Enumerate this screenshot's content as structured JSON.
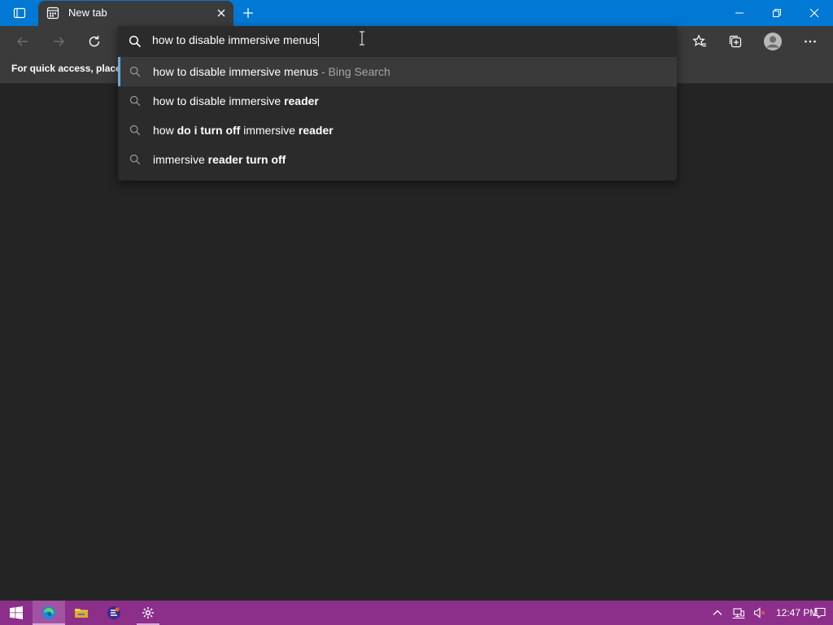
{
  "window": {
    "tab_title": "New tab",
    "colors": {
      "titlebar": "#0078d4",
      "toolbar": "#3b3b3b",
      "page": "#242424",
      "taskbar": "#8b2f8b"
    }
  },
  "favorites_bar": {
    "message": "For quick access, place y"
  },
  "omnibox": {
    "value": "how to disable immersive menus",
    "suggestions": [
      {
        "parts": [
          {
            "text": "how to disable immersive menus",
            "bold": false
          }
        ],
        "suffix": " - Bing Search"
      },
      {
        "parts": [
          {
            "text": "how to disable immersive ",
            "bold": false
          },
          {
            "text": "reader",
            "bold": true
          }
        ],
        "suffix": ""
      },
      {
        "parts": [
          {
            "text": "how ",
            "bold": false
          },
          {
            "text": "do i turn off",
            "bold": true
          },
          {
            "text": " immersive ",
            "bold": false
          },
          {
            "text": "reader",
            "bold": true
          }
        ],
        "suffix": ""
      },
      {
        "parts": [
          {
            "text": "immersive ",
            "bold": false
          },
          {
            "text": "reader turn off",
            "bold": true
          }
        ],
        "suffix": ""
      }
    ]
  },
  "toolbar": {
    "icons": [
      "back-icon",
      "forward-icon",
      "refresh-icon",
      "favorites-icon",
      "collections-icon",
      "profile-icon",
      "more-icon"
    ]
  },
  "taskbar": {
    "clock": "12:47 PM",
    "apps": [
      "start-icon",
      "edge-icon",
      "file-explorer-icon",
      "app-icon",
      "settings-icon"
    ]
  }
}
